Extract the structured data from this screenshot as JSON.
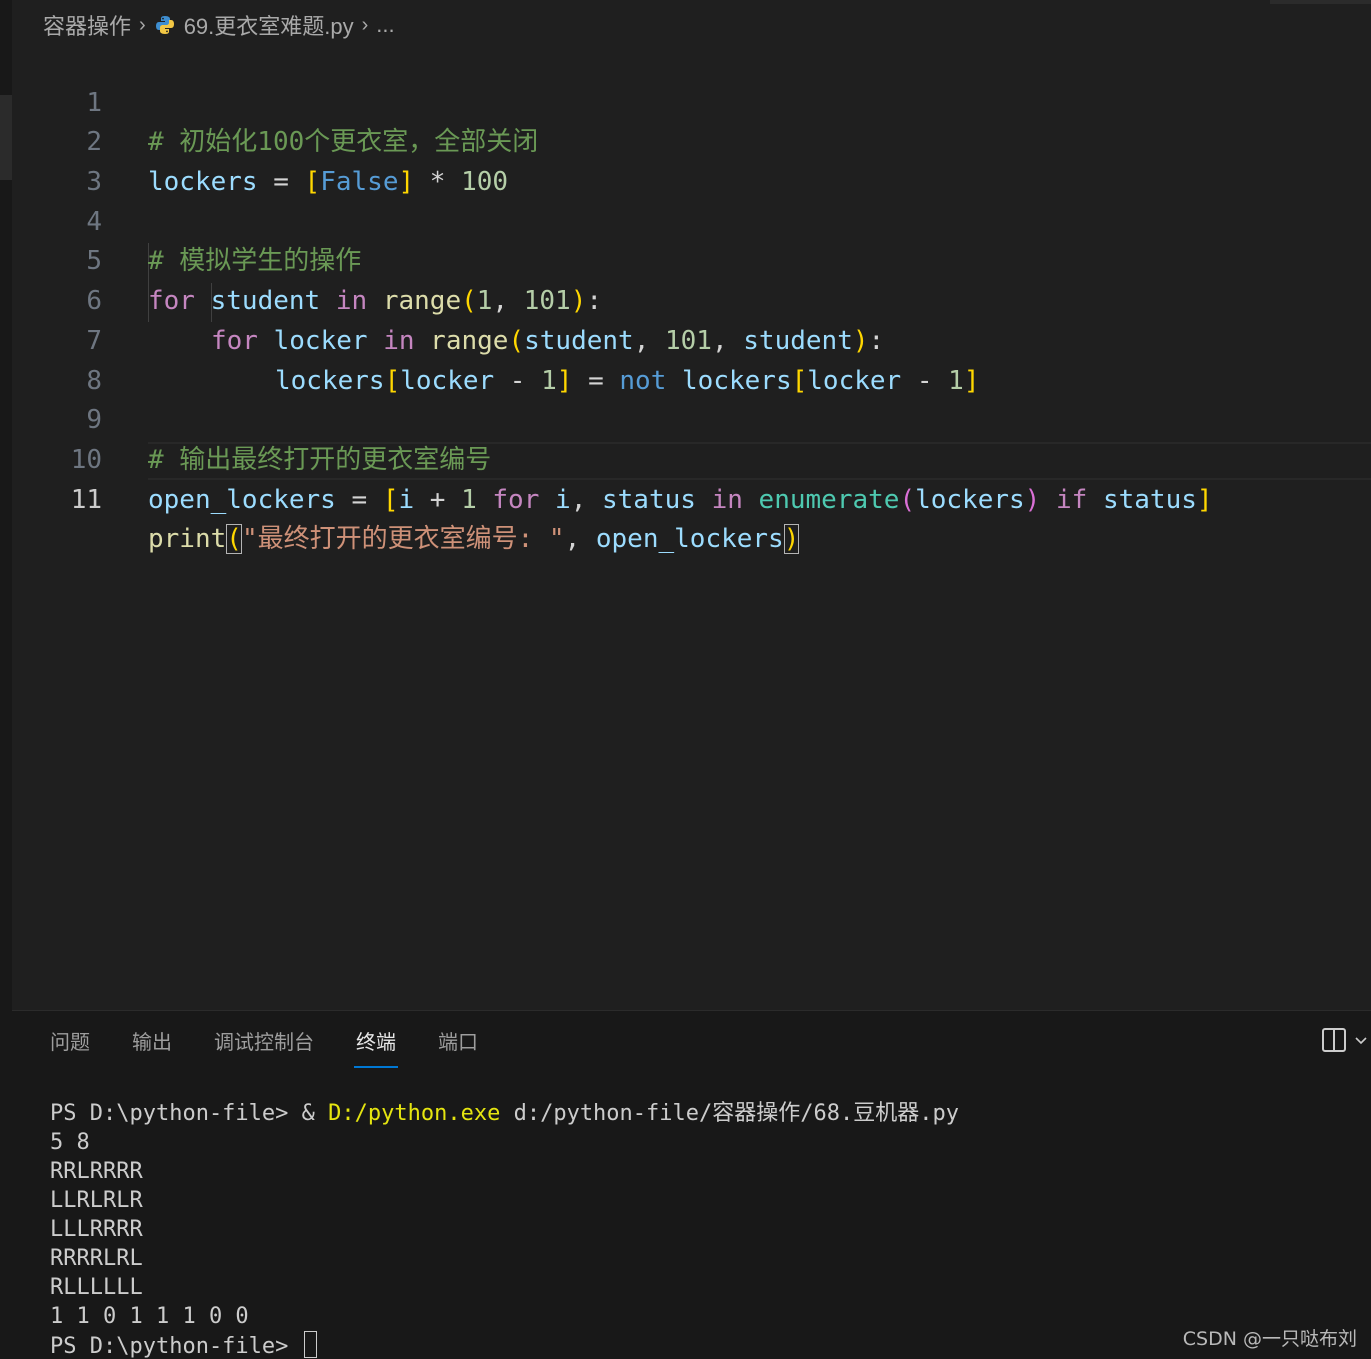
{
  "breadcrumb": {
    "folder": "容器操作",
    "file": "69.更衣室难题.py",
    "more": "..."
  },
  "code": {
    "lines": [
      {
        "n": "1"
      },
      {
        "n": "2"
      },
      {
        "n": "3"
      },
      {
        "n": "4"
      },
      {
        "n": "5"
      },
      {
        "n": "6"
      },
      {
        "n": "7"
      },
      {
        "n": "8"
      },
      {
        "n": "9"
      },
      {
        "n": "10"
      },
      {
        "n": "11"
      }
    ],
    "t": {
      "c1": "# 初始化100个更衣室，全部关闭",
      "lockers": "lockers",
      "eq": " = ",
      "lb": "[",
      "false": "False",
      "rb": "]",
      "mul": " * ",
      "n100": "100",
      "c4": "# 模拟学生的操作",
      "for": "for",
      "student": "student",
      "in": "in",
      "range": "range",
      "lp": "(",
      "rp": ")",
      "n1": "1",
      "comma": ", ",
      "n101": "101",
      "colon": ":",
      "locker": "locker",
      "minus": " - ",
      "not": "not",
      "c9": "# 输出最终打开的更衣室编号",
      "open_lockers": "open_lockers",
      "i": "i",
      "plus": " + ",
      "status": "status",
      "enumerate": "enumerate",
      "if": "if",
      "print": "print",
      "str": "\"最终打开的更衣室编号: \"",
      "sp": " "
    }
  },
  "panel": {
    "tabs": [
      "问题",
      "输出",
      "调试控制台",
      "终端",
      "端口"
    ],
    "active_tab": "终端"
  },
  "terminal": {
    "cmd_prefix": "PS D:\\python-file> & ",
    "cmd_exe": "D:/python.exe",
    "cmd_arg": " d:/python-file/容器操作/68.豆机器.py",
    "output": [
      "5 8",
      "RRLRRRR",
      "LLRLRLR",
      "LLLRRRR",
      "RRRRLRL",
      "RLLLLLL",
      "1 1 0 1 1 1 0 0"
    ],
    "prompt": "PS D:\\python-file> "
  },
  "watermark": "CSDN @一只哒布刘",
  "colors": {
    "background": "#1f1f1f",
    "panel": "#181818",
    "active_tab_underline": "#0078d4"
  },
  "icons": {
    "file_icon": "python-icon",
    "layout_icon": "split-editor-icon",
    "dropdown_icon": "chevron-down-icon"
  }
}
